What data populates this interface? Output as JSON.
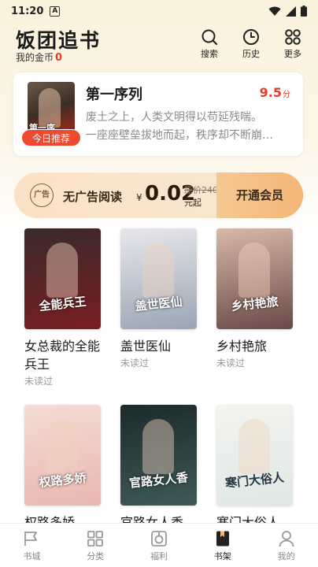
{
  "status_bar": {
    "time": "11:20",
    "icon": "A"
  },
  "header": {
    "title": "饭团追书",
    "coins_label": "我的金币",
    "coins_value": "0",
    "actions": [
      {
        "label": "搜索",
        "icon": "search-icon"
      },
      {
        "label": "历史",
        "icon": "clock-icon"
      },
      {
        "label": "更多",
        "icon": "grid-icon"
      }
    ]
  },
  "recommend": {
    "tag": "今日推荐",
    "cover_text": "第一序",
    "title": "第一序列",
    "score": "9.5",
    "score_unit": "分",
    "desc_lines": [
      "废土之上，人类文明得以苟延残喘。",
      "一座座壁垒拔地而起，秩序却不断崩…"
    ]
  },
  "vip": {
    "badge": "广告",
    "label": "无广告阅读",
    "currency": "¥",
    "price": "0.02",
    "old_price": "原价240元",
    "price_suffix": "元起",
    "button": "开通会员"
  },
  "books": [
    {
      "title": "女总裁的全能兵王",
      "status": "未读过",
      "cover_text": "全能兵王",
      "colors": [
        "#3a2a2a",
        "#7a1e22"
      ]
    },
    {
      "title": "盖世医仙",
      "status": "未读过",
      "cover_text": "盖世医仙",
      "colors": [
        "#e8e8ec",
        "#9aa5b5"
      ]
    },
    {
      "title": "乡村艳旅",
      "status": "未读过",
      "cover_text": "乡村艳旅",
      "colors": [
        "#d9b8a8",
        "#6a4a48"
      ]
    },
    {
      "title": "权路多娇",
      "status": "",
      "cover_text": "权路多娇",
      "colors": [
        "#f4dcd6",
        "#e9b7b0"
      ]
    },
    {
      "title": "官路女人香",
      "status": "",
      "cover_text": "官路女人香",
      "colors": [
        "#1c2a2a",
        "#3e5a58"
      ]
    },
    {
      "title": "寒门大俗人",
      "status": "",
      "cover_text": "寒门大俗人",
      "colors": [
        "#f4f4f0",
        "#dfe8e4"
      ]
    }
  ],
  "nav": [
    {
      "label": "书城",
      "icon": "store-icon",
      "active": false
    },
    {
      "label": "分类",
      "icon": "category-icon",
      "active": false
    },
    {
      "label": "福利",
      "icon": "gift-icon",
      "active": false
    },
    {
      "label": "书架",
      "icon": "bookshelf-icon",
      "active": true
    },
    {
      "label": "我的",
      "icon": "profile-icon",
      "active": false
    }
  ]
}
